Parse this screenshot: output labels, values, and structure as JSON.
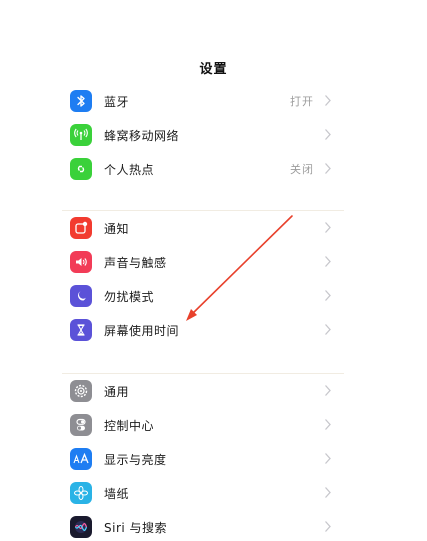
{
  "header": {
    "title": "设置"
  },
  "groups": [
    {
      "items": [
        {
          "label": "蓝牙",
          "value": "打开",
          "icon": "bluetooth-icon",
          "color": "#1e7df2"
        },
        {
          "label": "蜂窝移动网络",
          "value": "",
          "icon": "cellular-icon",
          "color": "#3ad13a"
        },
        {
          "label": "个人热点",
          "value": "关闭",
          "icon": "hotspot-icon",
          "color": "#3ad13a"
        }
      ]
    },
    {
      "items": [
        {
          "label": "通知",
          "value": "",
          "icon": "notifications-icon",
          "color": "#f23b2f"
        },
        {
          "label": "声音与触感",
          "value": "",
          "icon": "sound-icon",
          "color": "#f23c57"
        },
        {
          "label": "勿扰模式",
          "value": "",
          "icon": "moon-icon",
          "color": "#5b52d8"
        },
        {
          "label": "屏幕使用时间",
          "value": "",
          "icon": "hourglass-icon",
          "color": "#5b52d8"
        }
      ]
    },
    {
      "items": [
        {
          "label": "通用",
          "value": "",
          "icon": "gear-icon",
          "color": "#8e8e93"
        },
        {
          "label": "控制中心",
          "value": "",
          "icon": "toggles-icon",
          "color": "#8e8e93"
        },
        {
          "label": "显示与亮度",
          "value": "",
          "icon": "text-size-icon",
          "color": "#1e7df2"
        },
        {
          "label": "墙纸",
          "value": "",
          "icon": "flower-icon",
          "color": "#2ab3e6"
        },
        {
          "label": "Siri 与搜索",
          "value": "",
          "icon": "siri-icon",
          "color": "#1a1a2e"
        }
      ]
    }
  ],
  "annotation": {
    "arrow_color": "#e8412c",
    "icon": "red-arrow-annotation"
  }
}
